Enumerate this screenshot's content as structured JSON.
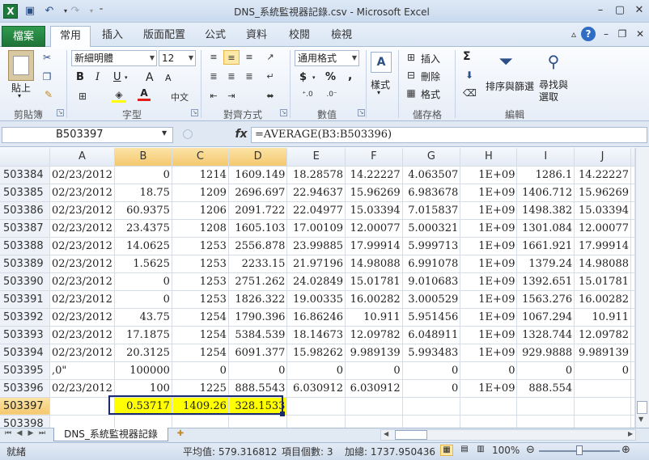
{
  "title_bar": {
    "app_icon": "X",
    "window_title": "DNS_系統監視器記錄.csv - Microsoft Excel",
    "qat_icons": [
      "save-icon",
      "undo-icon",
      "redo-icon",
      "customize-icon"
    ]
  },
  "tabs": [
    "檔案",
    "常用",
    "插入",
    "版面配置",
    "公式",
    "資料",
    "校閱",
    "檢視"
  ],
  "ribbon": {
    "clipboard": {
      "paste": "貼上",
      "group": "剪貼簿"
    },
    "font": {
      "name": "新細明體",
      "size": "12",
      "group": "字型",
      "bold": "B",
      "italic": "I",
      "underline": "U",
      "grow": "A",
      "shrink": "A"
    },
    "alignment": {
      "group": "對齊方式"
    },
    "number": {
      "format": "通用格式",
      "currency": "$",
      "percent": "%",
      "comma": ",",
      "group": "數值"
    },
    "styles": {
      "label": "樣式"
    },
    "cells": {
      "insert": "插入",
      "delete": "刪除",
      "format": "格式",
      "group": "儲存格"
    },
    "editing": {
      "sigma": "Σ",
      "sort_filter": "排序與篩選",
      "find_select": "尋找與選取",
      "group": "編輯"
    }
  },
  "formula_bar": {
    "name_box": "B503397",
    "fx": "fx",
    "formula": "=AVERAGE(B3:B503396)"
  },
  "grid": {
    "columns": [
      "A",
      "B",
      "C",
      "D",
      "E",
      "F",
      "G",
      "H",
      "I",
      "J"
    ],
    "rows": [
      {
        "num": "503384",
        "cells": [
          "02/23/2012",
          "0",
          "1214",
          "1609.149",
          "18.28578",
          "14.22227",
          "4.063507",
          "1E+09",
          "1286.1",
          "14.22227"
        ]
      },
      {
        "num": "503385",
        "cells": [
          "02/23/2012",
          "18.75",
          "1209",
          "2696.697",
          "22.94637",
          "15.96269",
          "6.983678",
          "1E+09",
          "1406.712",
          "15.96269"
        ]
      },
      {
        "num": "503386",
        "cells": [
          "02/23/2012",
          "60.9375",
          "1206",
          "2091.722",
          "22.04977",
          "15.03394",
          "7.015837",
          "1E+09",
          "1498.382",
          "15.03394"
        ]
      },
      {
        "num": "503387",
        "cells": [
          "02/23/2012",
          "23.4375",
          "1208",
          "1605.103",
          "17.00109",
          "12.00077",
          "5.000321",
          "1E+09",
          "1301.084",
          "12.00077"
        ]
      },
      {
        "num": "503388",
        "cells": [
          "02/23/2012",
          "14.0625",
          "1253",
          "2556.878",
          "23.99885",
          "17.99914",
          "5.999713",
          "1E+09",
          "1661.921",
          "17.99914"
        ]
      },
      {
        "num": "503389",
        "cells": [
          "02/23/2012",
          "1.5625",
          "1253",
          "2233.15",
          "21.97196",
          "14.98088",
          "6.991078",
          "1E+09",
          "1379.24",
          "14.98088"
        ]
      },
      {
        "num": "503390",
        "cells": [
          "02/23/2012",
          "0",
          "1253",
          "2751.262",
          "24.02849",
          "15.01781",
          "9.010683",
          "1E+09",
          "1392.651",
          "15.01781"
        ]
      },
      {
        "num": "503391",
        "cells": [
          "02/23/2012",
          "0",
          "1253",
          "1826.322",
          "19.00335",
          "16.00282",
          "3.000529",
          "1E+09",
          "1563.276",
          "16.00282"
        ]
      },
      {
        "num": "503392",
        "cells": [
          "02/23/2012",
          "43.75",
          "1254",
          "1790.396",
          "16.86246",
          "10.911",
          "5.951456",
          "1E+09",
          "1067.294",
          "10.911"
        ]
      },
      {
        "num": "503393",
        "cells": [
          "02/23/2012",
          "17.1875",
          "1254",
          "5384.539",
          "18.14673",
          "12.09782",
          "6.048911",
          "1E+09",
          "1328.744",
          "12.09782"
        ]
      },
      {
        "num": "503394",
        "cells": [
          "02/23/2012",
          "20.3125",
          "1254",
          "6091.377",
          "15.98262",
          "9.989139",
          "5.993483",
          "1E+09",
          "929.9888",
          "9.989139"
        ]
      },
      {
        "num": "503395",
        "cells": [
          ",0\"",
          "100000",
          "0",
          "0",
          "0",
          "0",
          "0",
          "0",
          "0",
          "0"
        ]
      },
      {
        "num": "503396",
        "cells": [
          "02/23/2012",
          "100",
          "1225",
          "888.5543",
          "6.030912",
          "6.030912",
          "0",
          "1E+09",
          "888.554",
          ""
        ]
      },
      {
        "num": "503397",
        "cells": [
          "",
          "0.53717",
          "1409.26",
          "328.1533",
          "",
          "",
          "",
          "",
          "",
          ""
        ]
      },
      {
        "num": "503398",
        "cells": [
          "",
          "",
          "",
          "",
          "",
          "",
          "",
          "",
          "",
          ""
        ]
      }
    ]
  },
  "sheet_tab": "DNS_系統監視器記錄",
  "status": {
    "ready": "就緒",
    "average": "平均值: 579.316812",
    "count": "項目個數: 3",
    "sum": "加總: 1737.950436",
    "zoom": "100%",
    "zoom_out": "⊖",
    "zoom_in": "⊕"
  }
}
